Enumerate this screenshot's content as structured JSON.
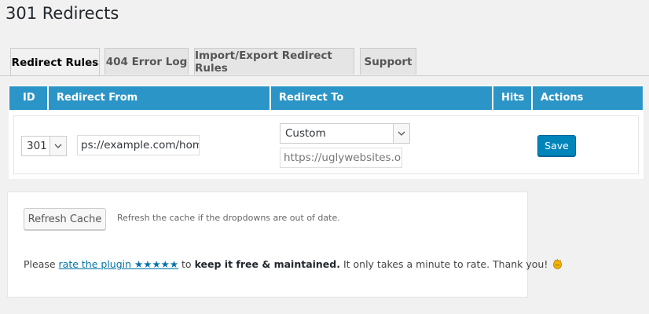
{
  "page": {
    "title": "301 Redirects"
  },
  "tabs": [
    {
      "label": "Redirect Rules",
      "active": true
    },
    {
      "label": "404 Error Log",
      "active": false
    },
    {
      "label": "Import/Export Redirect Rules",
      "active": false
    },
    {
      "label": "Support",
      "active": false
    }
  ],
  "table": {
    "header_color": "#2b95c8",
    "columns": [
      "ID",
      "Redirect From",
      "Redirect To",
      "Hits",
      "Actions"
    ],
    "row": {
      "status_code": "301",
      "redirect_from": "ps://example.com/home",
      "redirect_to_type": "Custom",
      "redirect_to_url": "https://uglywebsites.org",
      "hits": "",
      "save_label": "Save"
    }
  },
  "cache": {
    "button_label": "Refresh Cache",
    "help_text": "Refresh the cache if the dropdowns are out of date."
  },
  "rating": {
    "prefix": "Please ",
    "link_text": "rate the plugin ★★★★★",
    "middle": " to ",
    "bold_text": "keep it free & maintained.",
    "suffix": " It only takes a minute to rate. Thank you!",
    "icon": "clapping-hands-icon"
  }
}
